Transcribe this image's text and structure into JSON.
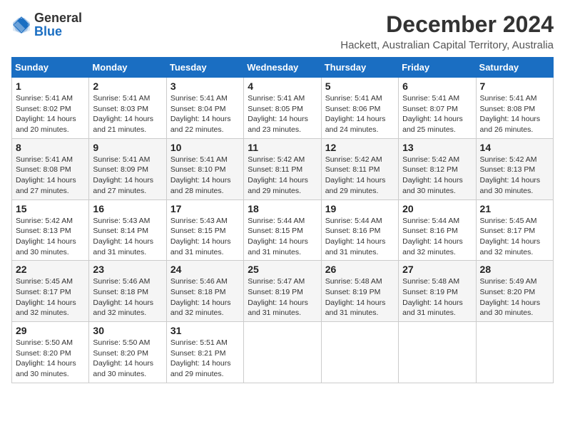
{
  "logo": {
    "general": "General",
    "blue": "Blue"
  },
  "title": "December 2024",
  "subtitle": "Hackett, Australian Capital Territory, Australia",
  "days_header": [
    "Sunday",
    "Monday",
    "Tuesday",
    "Wednesday",
    "Thursday",
    "Friday",
    "Saturday"
  ],
  "weeks": [
    [
      {
        "day": "1",
        "sunrise": "Sunrise: 5:41 AM",
        "sunset": "Sunset: 8:02 PM",
        "daylight": "Daylight: 14 hours and 20 minutes."
      },
      {
        "day": "2",
        "sunrise": "Sunrise: 5:41 AM",
        "sunset": "Sunset: 8:03 PM",
        "daylight": "Daylight: 14 hours and 21 minutes."
      },
      {
        "day": "3",
        "sunrise": "Sunrise: 5:41 AM",
        "sunset": "Sunset: 8:04 PM",
        "daylight": "Daylight: 14 hours and 22 minutes."
      },
      {
        "day": "4",
        "sunrise": "Sunrise: 5:41 AM",
        "sunset": "Sunset: 8:05 PM",
        "daylight": "Daylight: 14 hours and 23 minutes."
      },
      {
        "day": "5",
        "sunrise": "Sunrise: 5:41 AM",
        "sunset": "Sunset: 8:06 PM",
        "daylight": "Daylight: 14 hours and 24 minutes."
      },
      {
        "day": "6",
        "sunrise": "Sunrise: 5:41 AM",
        "sunset": "Sunset: 8:07 PM",
        "daylight": "Daylight: 14 hours and 25 minutes."
      },
      {
        "day": "7",
        "sunrise": "Sunrise: 5:41 AM",
        "sunset": "Sunset: 8:08 PM",
        "daylight": "Daylight: 14 hours and 26 minutes."
      }
    ],
    [
      {
        "day": "8",
        "sunrise": "Sunrise: 5:41 AM",
        "sunset": "Sunset: 8:08 PM",
        "daylight": "Daylight: 14 hours and 27 minutes."
      },
      {
        "day": "9",
        "sunrise": "Sunrise: 5:41 AM",
        "sunset": "Sunset: 8:09 PM",
        "daylight": "Daylight: 14 hours and 27 minutes."
      },
      {
        "day": "10",
        "sunrise": "Sunrise: 5:41 AM",
        "sunset": "Sunset: 8:10 PM",
        "daylight": "Daylight: 14 hours and 28 minutes."
      },
      {
        "day": "11",
        "sunrise": "Sunrise: 5:42 AM",
        "sunset": "Sunset: 8:11 PM",
        "daylight": "Daylight: 14 hours and 29 minutes."
      },
      {
        "day": "12",
        "sunrise": "Sunrise: 5:42 AM",
        "sunset": "Sunset: 8:11 PM",
        "daylight": "Daylight: 14 hours and 29 minutes."
      },
      {
        "day": "13",
        "sunrise": "Sunrise: 5:42 AM",
        "sunset": "Sunset: 8:12 PM",
        "daylight": "Daylight: 14 hours and 30 minutes."
      },
      {
        "day": "14",
        "sunrise": "Sunrise: 5:42 AM",
        "sunset": "Sunset: 8:13 PM",
        "daylight": "Daylight: 14 hours and 30 minutes."
      }
    ],
    [
      {
        "day": "15",
        "sunrise": "Sunrise: 5:42 AM",
        "sunset": "Sunset: 8:13 PM",
        "daylight": "Daylight: 14 hours and 30 minutes."
      },
      {
        "day": "16",
        "sunrise": "Sunrise: 5:43 AM",
        "sunset": "Sunset: 8:14 PM",
        "daylight": "Daylight: 14 hours and 31 minutes."
      },
      {
        "day": "17",
        "sunrise": "Sunrise: 5:43 AM",
        "sunset": "Sunset: 8:15 PM",
        "daylight": "Daylight: 14 hours and 31 minutes."
      },
      {
        "day": "18",
        "sunrise": "Sunrise: 5:44 AM",
        "sunset": "Sunset: 8:15 PM",
        "daylight": "Daylight: 14 hours and 31 minutes."
      },
      {
        "day": "19",
        "sunrise": "Sunrise: 5:44 AM",
        "sunset": "Sunset: 8:16 PM",
        "daylight": "Daylight: 14 hours and 31 minutes."
      },
      {
        "day": "20",
        "sunrise": "Sunrise: 5:44 AM",
        "sunset": "Sunset: 8:16 PM",
        "daylight": "Daylight: 14 hours and 32 minutes."
      },
      {
        "day": "21",
        "sunrise": "Sunrise: 5:45 AM",
        "sunset": "Sunset: 8:17 PM",
        "daylight": "Daylight: 14 hours and 32 minutes."
      }
    ],
    [
      {
        "day": "22",
        "sunrise": "Sunrise: 5:45 AM",
        "sunset": "Sunset: 8:17 PM",
        "daylight": "Daylight: 14 hours and 32 minutes."
      },
      {
        "day": "23",
        "sunrise": "Sunrise: 5:46 AM",
        "sunset": "Sunset: 8:18 PM",
        "daylight": "Daylight: 14 hours and 32 minutes."
      },
      {
        "day": "24",
        "sunrise": "Sunrise: 5:46 AM",
        "sunset": "Sunset: 8:18 PM",
        "daylight": "Daylight: 14 hours and 32 minutes."
      },
      {
        "day": "25",
        "sunrise": "Sunrise: 5:47 AM",
        "sunset": "Sunset: 8:19 PM",
        "daylight": "Daylight: 14 hours and 31 minutes."
      },
      {
        "day": "26",
        "sunrise": "Sunrise: 5:48 AM",
        "sunset": "Sunset: 8:19 PM",
        "daylight": "Daylight: 14 hours and 31 minutes."
      },
      {
        "day": "27",
        "sunrise": "Sunrise: 5:48 AM",
        "sunset": "Sunset: 8:19 PM",
        "daylight": "Daylight: 14 hours and 31 minutes."
      },
      {
        "day": "28",
        "sunrise": "Sunrise: 5:49 AM",
        "sunset": "Sunset: 8:20 PM",
        "daylight": "Daylight: 14 hours and 30 minutes."
      }
    ],
    [
      {
        "day": "29",
        "sunrise": "Sunrise: 5:50 AM",
        "sunset": "Sunset: 8:20 PM",
        "daylight": "Daylight: 14 hours and 30 minutes."
      },
      {
        "day": "30",
        "sunrise": "Sunrise: 5:50 AM",
        "sunset": "Sunset: 8:20 PM",
        "daylight": "Daylight: 14 hours and 30 minutes."
      },
      {
        "day": "31",
        "sunrise": "Sunrise: 5:51 AM",
        "sunset": "Sunset: 8:21 PM",
        "daylight": "Daylight: 14 hours and 29 minutes."
      },
      null,
      null,
      null,
      null
    ]
  ]
}
